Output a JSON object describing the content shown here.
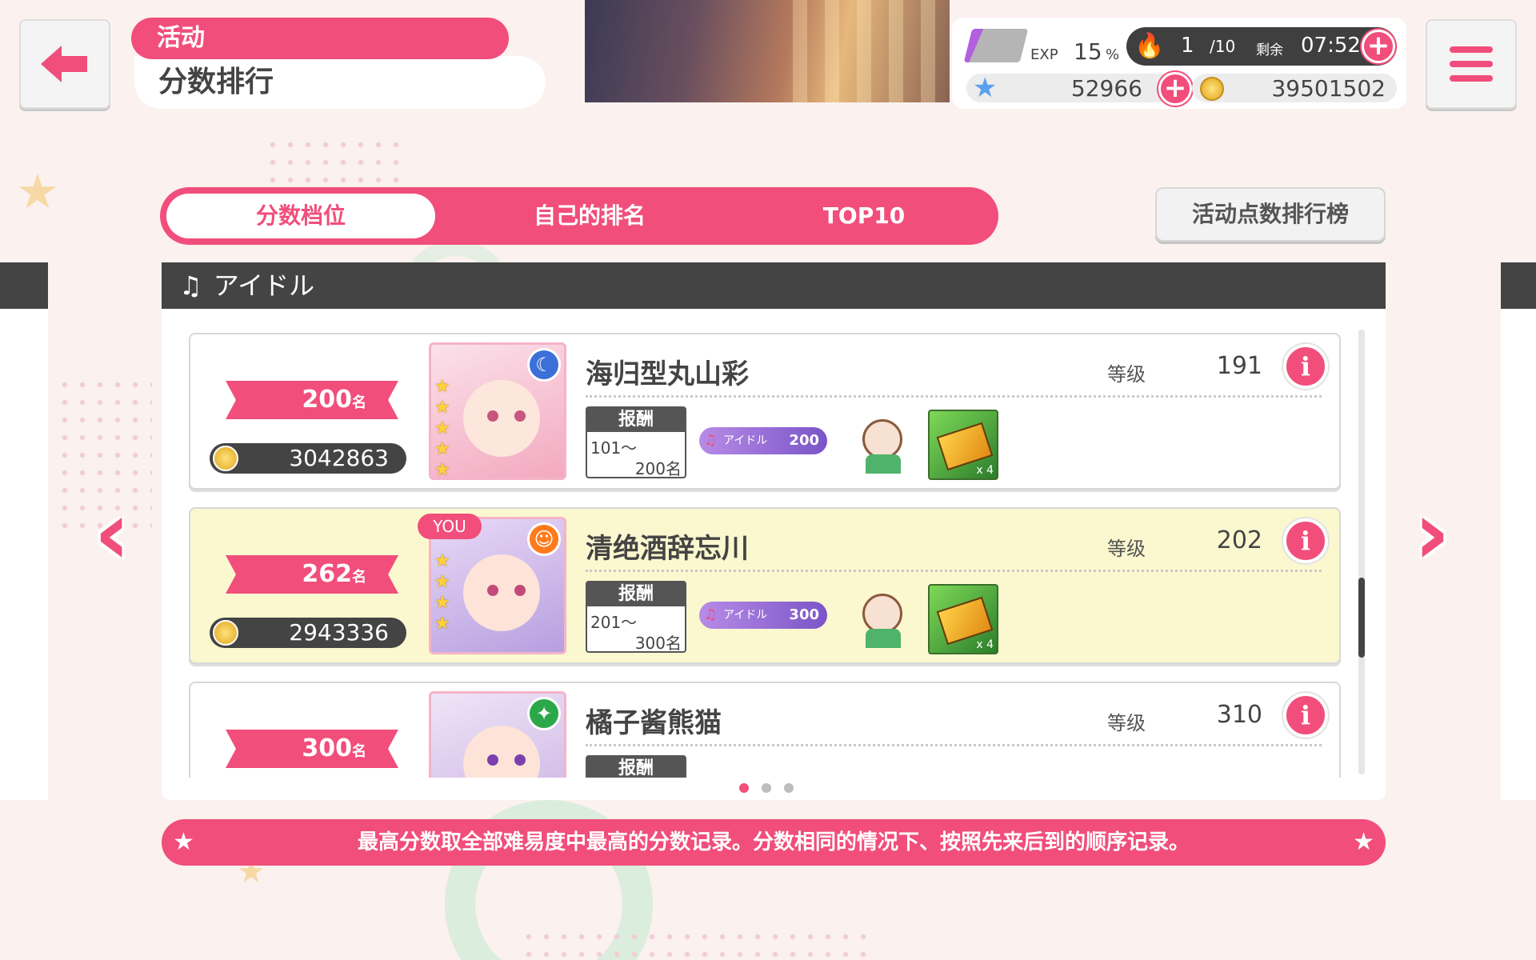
{
  "header": {
    "category": "活动",
    "title": "分数排行"
  },
  "status": {
    "exp_label": "EXP",
    "exp_value": "15",
    "exp_unit": "%",
    "exp_percent": 15,
    "stamina_current": "1",
    "stamina_max": "/10",
    "stamina_remaining_label": "剩余",
    "stamina_time": "07:52",
    "star_gems": "52966",
    "coins": "39501502"
  },
  "tabs": [
    {
      "label": "分数档位",
      "active": true
    },
    {
      "label": "自己的排名",
      "active": false
    },
    {
      "label": "TOP10",
      "active": false
    }
  ],
  "rank_board_button": "活动点数排行榜",
  "panel_title": "アイドル",
  "entries": [
    {
      "rank": "200",
      "rank_suffix": "名",
      "score": "3042863",
      "name": "海归型丸山彩",
      "level_label": "等级",
      "level": "191",
      "is_you": false,
      "reward_header": "报酬",
      "reward_from": "101～",
      "reward_to": "200名",
      "badge_text": "アイドル",
      "badge_tier": "200",
      "ticket_count": "x 4",
      "card_attr_color": "#3d6fd8",
      "card_bg": "#f7c9d3",
      "card_attr_icon": "moon-icon"
    },
    {
      "rank": "262",
      "rank_suffix": "名",
      "score": "2943336",
      "name": "清绝酒辞忘川",
      "level_label": "等级",
      "level": "202",
      "is_you": true,
      "you_label": "YOU",
      "reward_header": "报酬",
      "reward_from": "201～",
      "reward_to": "300名",
      "badge_text": "アイドル",
      "badge_tier": "300",
      "ticket_count": "x 4",
      "card_attr_color": "#ff7a1a",
      "card_bg": "#c7b3e6",
      "card_attr_icon": "smile-icon"
    },
    {
      "rank": "300",
      "rank_suffix": "名",
      "name": "橘子酱熊猫",
      "level_label": "等级",
      "level": "310",
      "is_you": false,
      "reward_header": "报酬",
      "card_attr_color": "#2ca84a",
      "card_bg": "#d4c2ea",
      "card_attr_icon": "sparkle-icon"
    }
  ],
  "pager": {
    "pages": 3,
    "current": 1
  },
  "footer_note": "最高分数取全部难易度中最高的分数记录。分数相同的情况下、按照先来后到的顺序记录。",
  "colors": {
    "accent": "#f14e7b",
    "dark": "#444444",
    "highlight_row": "#fbf8cf"
  }
}
